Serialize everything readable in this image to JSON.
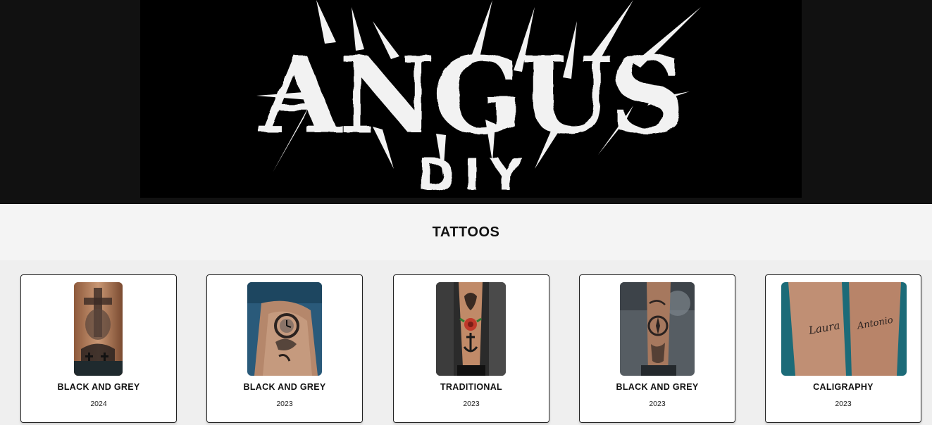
{
  "banner": {
    "logo_word": "ANGUS",
    "logo_sub": "DIY"
  },
  "section": {
    "title": "TATTOOS"
  },
  "cards": [
    {
      "style": "BLACK AND GREY",
      "year": "2024",
      "photo": "tattoo-cross-skull-photo"
    },
    {
      "style": "BLACK AND GREY",
      "year": "2023",
      "photo": "tattoo-clock-rose-photo"
    },
    {
      "style": "TRADITIONAL",
      "year": "2023",
      "photo": "tattoo-traditional-anchor-photo"
    },
    {
      "style": "BLACK AND GREY",
      "year": "2023",
      "photo": "tattoo-compass-forearm-photo"
    },
    {
      "style": "CALIGRAPHY",
      "year": "2023",
      "photo": "tattoo-names-script-photo",
      "inscriptions": [
        "Laura",
        "Antonio"
      ]
    }
  ],
  "colors": {
    "hero_bg": "#111111",
    "banner_bg": "#000000",
    "logo": "#f2f2f2",
    "section_bg": "#f4f4f4",
    "page_bg": "#efefef",
    "card_bg": "#ffffff"
  }
}
